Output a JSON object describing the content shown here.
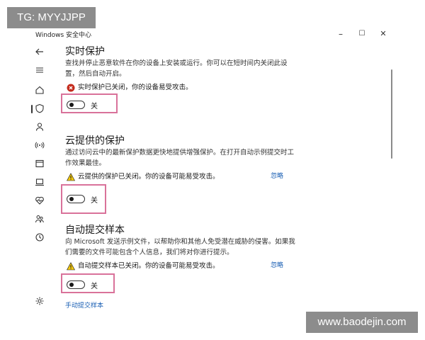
{
  "watermarks": {
    "top_left": "TG: MYYJJPP",
    "bottom_right": "www.baodejin.com"
  },
  "window": {
    "title": "Windows 安全中心",
    "controls": {
      "minimize": "–",
      "maximize": "☐",
      "close": "✕"
    }
  },
  "sidebar": {
    "icons": [
      "back-arrow-icon",
      "menu-icon",
      "home-icon",
      "shield-icon",
      "account-icon",
      "wifi-icon",
      "app-browser-icon",
      "device-icon",
      "health-icon",
      "family-icon",
      "history-icon",
      "settings-icon"
    ],
    "active": "shield-icon"
  },
  "sections": {
    "realtime": {
      "title": "实时保护",
      "description": "查找并停止恶意软件在你的设备上安装或运行。你可以在短时间内关闭此设置，然后自动开启。",
      "status": "实时保护已关闭，你的设备易受攻击。",
      "status_color": "#c42b1c",
      "toggle_label": "关",
      "toggle_on": false
    },
    "cloud": {
      "title": "云提供的保护",
      "description": "通过访问云中的最新保护数据更快地提供增强保护。在打开自动示例提交时工作效果最佳。",
      "status": "云提供的保护已关闭。你的设备可能易受攻击。",
      "status_color": "#f2c811",
      "dismiss": "忽略",
      "toggle_label": "关",
      "toggle_on": false
    },
    "sample": {
      "title": "自动提交样本",
      "description": "向 Microsoft 发送示例文件，以帮助你和其他人免受潜在威胁的侵害。如果我们需要的文件可能包含个人信息，我们将对你进行提示。",
      "status": "自动提交样本已关闭。你的设备可能易受攻击。",
      "status_color": "#f2c811",
      "dismiss": "忽略",
      "toggle_label": "关",
      "toggle_on": false,
      "manual_link": "手动提交样本"
    }
  },
  "highlight_color": "#d9729a"
}
